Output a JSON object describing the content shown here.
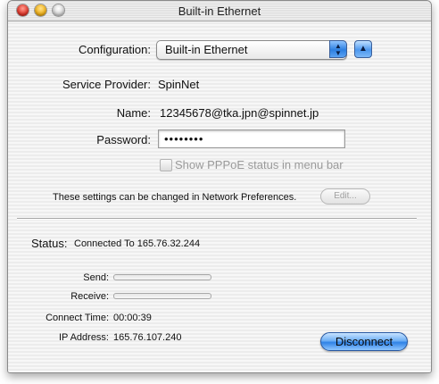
{
  "window": {
    "title": "Built-in Ethernet"
  },
  "config": {
    "configuration_label": "Configuration:",
    "configuration_value": "Built-in Ethernet",
    "provider_label": "Service Provider:",
    "provider_value": "SpinNet",
    "name_label": "Name:",
    "name_value": "12345678@tka.jpn@spinnet.jp",
    "password_label": "Password:",
    "password_value": "••••••••",
    "pppoe_checkbox_label": "Show PPPoE status in menu bar",
    "pppoe_checked": false,
    "note_text": "These settings can be changed in Network Preferences.",
    "edit_label": "Edit..."
  },
  "status": {
    "status_label": "Status:",
    "status_value": "Connected To 165.76.32.244",
    "send_label": "Send:",
    "send_level": 0,
    "receive_label": "Receive:",
    "receive_level": 0,
    "connect_time_label": "Connect Time:",
    "connect_time_value": "00:00:39",
    "ip_label": "IP Address:",
    "ip_value": "165.76.107.240",
    "disconnect_label": "Disconnect"
  }
}
